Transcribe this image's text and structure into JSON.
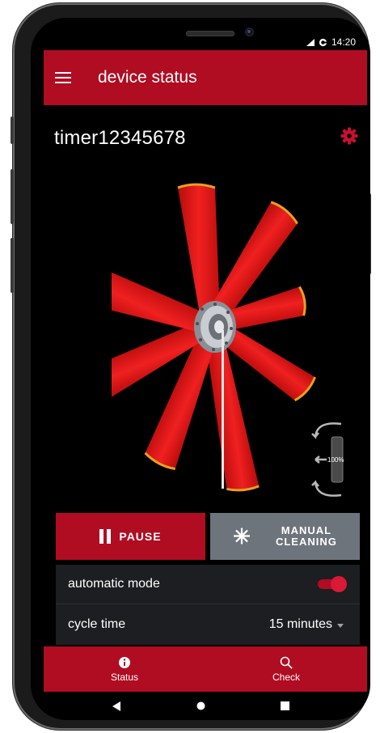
{
  "status_bar": {
    "time": "14:20"
  },
  "app_bar": {
    "title": "device status",
    "menu_icon": "hamburger-menu-icon"
  },
  "device": {
    "name": "timer12345678",
    "settings_icon": "gear-icon"
  },
  "indicator": {
    "percent_label": "100%"
  },
  "actions": {
    "pause_label": "PAUSE",
    "manual_line1": "MANUAL",
    "manual_line2": "CLEANING"
  },
  "settings": {
    "automatic_mode_label": "automatic mode",
    "automatic_mode_on": true,
    "cycle_time_label": "cycle time",
    "cycle_time_value": "15 minutes"
  },
  "bottom_nav": [
    {
      "label": "Status",
      "icon": "info-icon"
    },
    {
      "label": "Check",
      "icon": "search-icon"
    }
  ],
  "colors": {
    "accent": "#b00c22",
    "manual_button": "#6e747c",
    "row_bg": "#1c1e21"
  }
}
